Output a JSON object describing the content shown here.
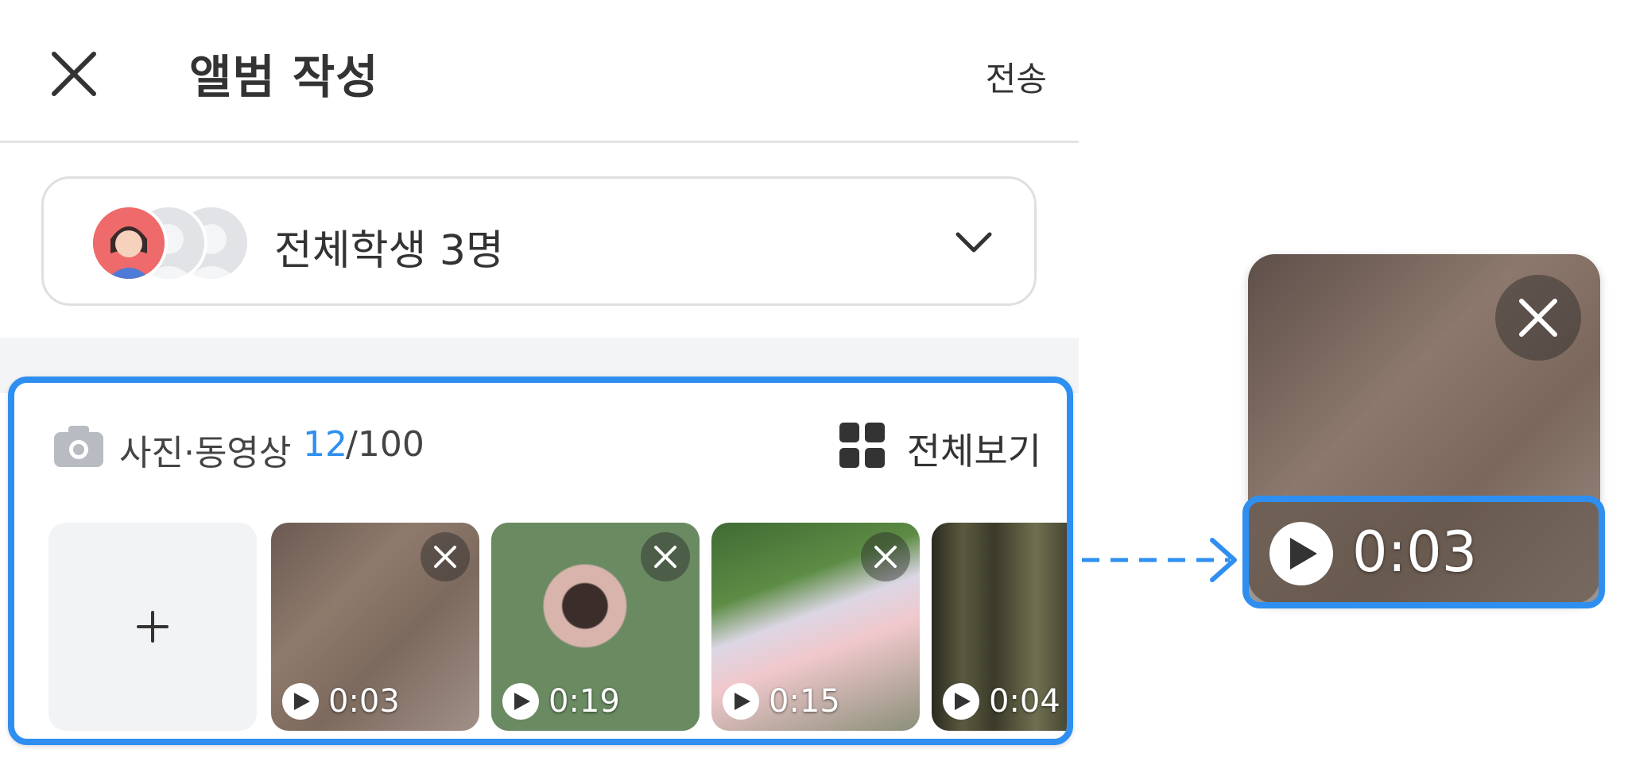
{
  "header": {
    "title": "앨범 작성",
    "send_label": "전송"
  },
  "recipient": {
    "label": "전체학생 3명"
  },
  "media": {
    "label": "사진·동영상",
    "count": "12",
    "total": "/100",
    "view_all_label": "전체보기",
    "items": [
      {
        "duration": "0:03"
      },
      {
        "duration": "0:19"
      },
      {
        "duration": "0:15"
      },
      {
        "duration": "0:04"
      }
    ]
  },
  "zoom_preview": {
    "duration": "0:03"
  },
  "colors": {
    "accent": "#2e8ff0",
    "text": "#333333",
    "tile_bg": "#f2f3f5"
  }
}
